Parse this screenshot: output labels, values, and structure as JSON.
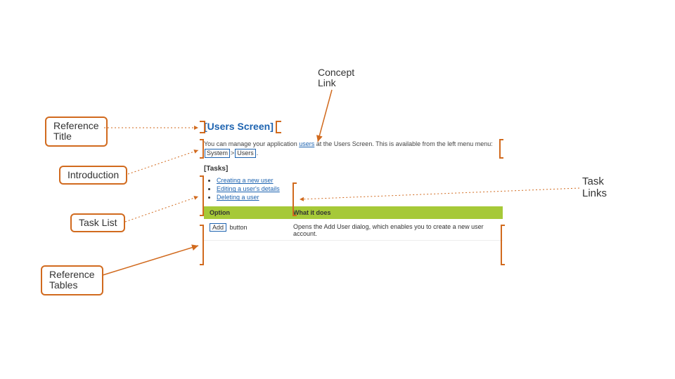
{
  "labels": {
    "concept_link": "Concept\nLink",
    "reference_title": "Reference\nTitle",
    "introduction": "Introduction",
    "task_list": "Task List",
    "reference_tables": "Reference\nTables",
    "task_links": "Task\nLinks"
  },
  "doc": {
    "title": "Users Screen",
    "intro_pre": "You can manage your application ",
    "intro_link": "users",
    "intro_post": " at the Users Screen. This is available from the left menu menu: ",
    "breadcrumb": {
      "system": "System",
      "users": "Users"
    },
    "tasks_heading": "Tasks",
    "tasks": [
      "Creating a new user",
      "Editing a user's details",
      "Deleting a user"
    ],
    "table": {
      "headers": {
        "option": "Option",
        "what": "What it does"
      },
      "rows": [
        {
          "option_chip": "Add",
          "option_suffix": " button",
          "what": "Opens the Add User dialog, which enables you to create a new user account."
        }
      ]
    }
  }
}
